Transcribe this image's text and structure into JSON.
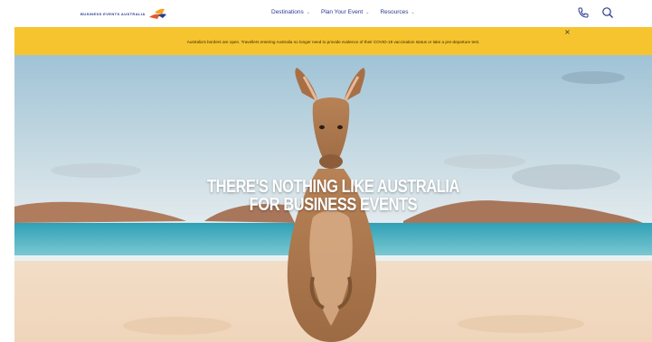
{
  "header": {
    "logo_text": "BUSINESS EVENTS AUSTRALIA",
    "nav": [
      {
        "label": "Destinations",
        "icon": "chevron-down"
      },
      {
        "label": "Plan Your Event",
        "icon": "chevron-down"
      },
      {
        "label": "Resources",
        "icon": "chevron-down"
      }
    ],
    "icons": [
      "phone-icon",
      "search-icon"
    ]
  },
  "banner": {
    "text": "Australia's borders are open. Travellers entering Australia no longer need to provide evidence of their COVID-19 vaccination status or take a pre-departure test.",
    "close_icon": "close-icon",
    "color": "#f6c42e"
  },
  "hero": {
    "title_line1": "THERE'S NOTHING LIKE AUSTRALIA",
    "title_line2": "FOR BUSINESS EVENTS"
  },
  "colors": {
    "brand_blue": "#2b3a8f",
    "banner_yellow": "#f6c42e"
  }
}
